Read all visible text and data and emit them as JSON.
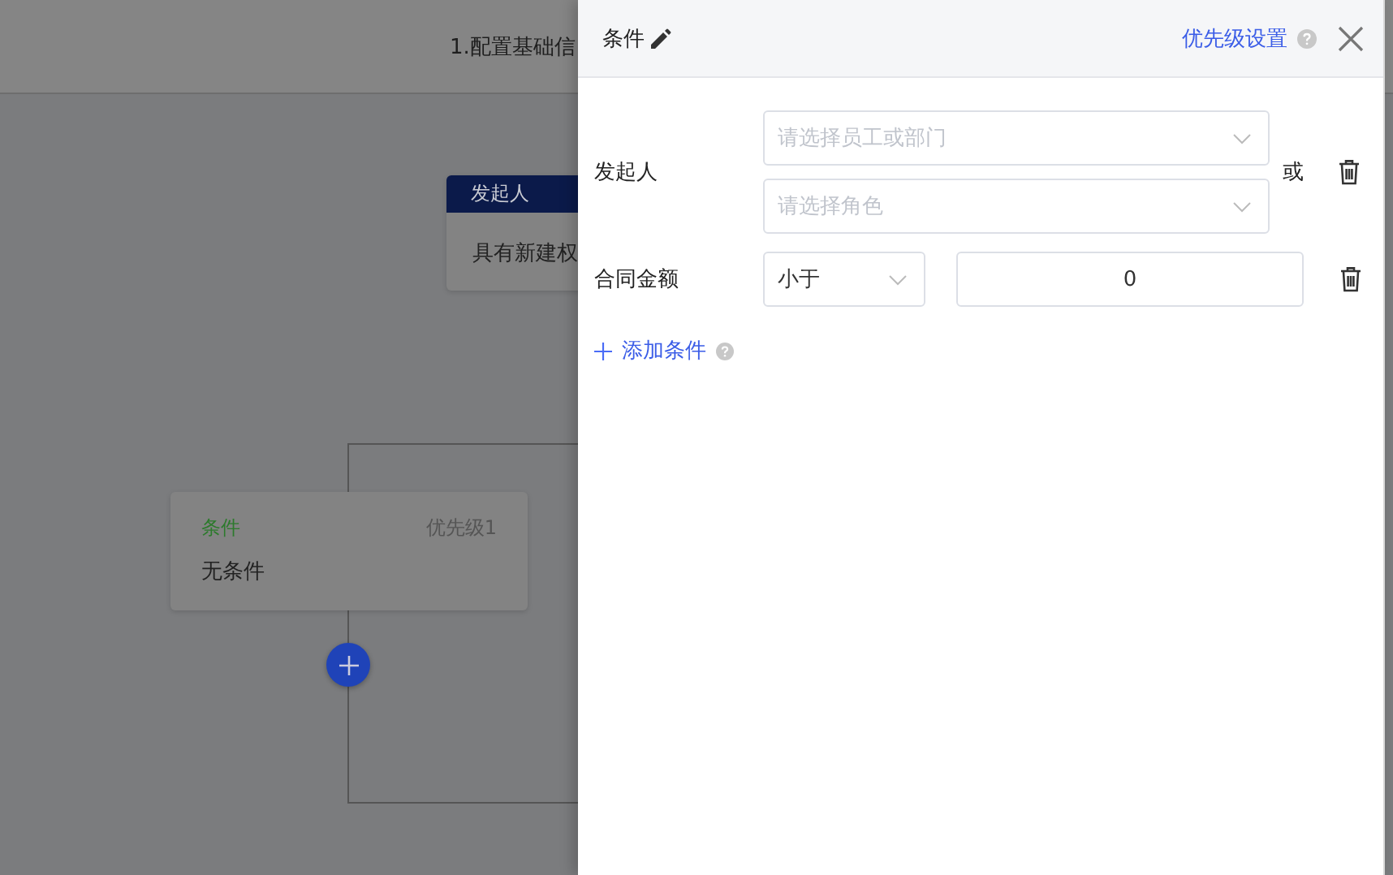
{
  "background": {
    "header_title": "1.配置基础信",
    "nodes": [
      {
        "kind": "initiator",
        "title": "发起人",
        "body": "具有新建权"
      },
      {
        "kind": "condition",
        "title": "条件",
        "priority": "优先级1",
        "body": "无条件"
      }
    ]
  },
  "drawer": {
    "title": "条件",
    "priority_link": "优先级设置",
    "conditions": [
      {
        "kind": "multi",
        "label": "发起人",
        "fields": [
          {
            "placeholder": "请选择员工或部门"
          },
          {
            "placeholder": "请选择角色"
          }
        ],
        "joiner": "或"
      },
      {
        "kind": "compare",
        "label": "合同金额",
        "operator": "小于",
        "value": "0"
      }
    ],
    "add_label": "添加条件"
  }
}
